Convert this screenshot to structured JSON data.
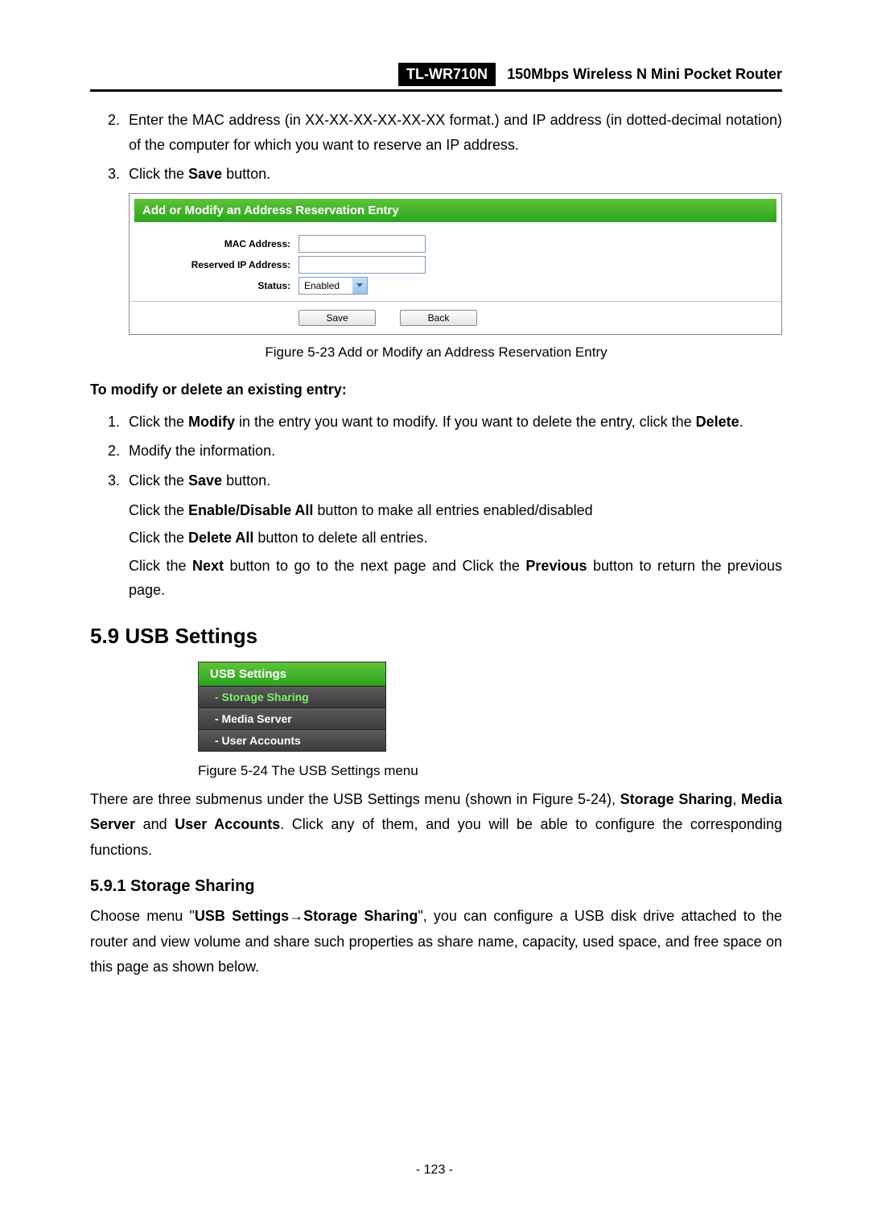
{
  "header": {
    "model": "TL-WR710N",
    "tagline": "150Mbps Wireless N Mini Pocket Router"
  },
  "steps_a": {
    "i2_pre": "Enter the MAC address (in XX-XX-XX-XX-XX-XX format.) and IP address (in dotted-decimal notation) of the computer for which you want to reserve an IP address.",
    "i3_pre": "Click the ",
    "i3_b": "Save",
    "i3_post": " button."
  },
  "fig23": {
    "title": "Add or Modify an Address Reservation Entry",
    "mac_label": "MAC Address:",
    "ip_label": "Reserved IP Address:",
    "status_label": "Status:",
    "status_value": "Enabled",
    "save": "Save",
    "back": "Back",
    "caption": "Figure 5-23    Add or Modify an Address Reservation Entry"
  },
  "subhead1": "To modify or delete an existing entry:",
  "steps_b": {
    "i1_a": "Click the ",
    "i1_b": "Modify",
    "i1_c": " in the entry you want to modify. If you want to delete the entry, click the ",
    "i1_d": "Delete",
    "i1_e": ".",
    "i2": "Modify the information.",
    "i3_a": "Click the ",
    "i3_b": "Save",
    "i3_c": " button."
  },
  "extras": {
    "p1_a": "Click the ",
    "p1_b": "Enable/Disable All",
    "p1_c": " button to make all entries enabled/disabled",
    "p2_a": "Click the ",
    "p2_b": "Delete All",
    "p2_c": " button to delete all entries.",
    "p3_a": "Click the ",
    "p3_b": "Next",
    "p3_c": " button to go to the next page and Click the ",
    "p3_d": "Previous",
    "p3_e": " button to return the previous page."
  },
  "sec": "5.9  USB Settings",
  "usbmenu": {
    "head": "USB Settings",
    "i1": "- Storage Sharing",
    "i2": "- Media Server",
    "i3": "- User Accounts",
    "caption": "Figure 5-24 The USB Settings menu"
  },
  "body1_a": "There are three submenus under the USB Settings menu (shown in Figure 5-24), ",
  "body1_b": "Storage Sharing",
  "body1_c": ", ",
  "body1_d": "Media Server",
  "body1_e": " and ",
  "body1_f": "User Accounts",
  "body1_g": ". Click any of them, and you will be able to configure the corresponding functions.",
  "subsec": "5.9.1  Storage Sharing",
  "body2_a": "Choose menu \"",
  "body2_b": "USB Settings",
  "body2_arrow": "→",
  "body2_c": "Storage Sharing",
  "body2_d": "\", you can configure a USB disk drive attached to the router and view volume and share such properties as share name, capacity, used space, and free space on this page as shown below.",
  "pagenum": "- 123 -"
}
